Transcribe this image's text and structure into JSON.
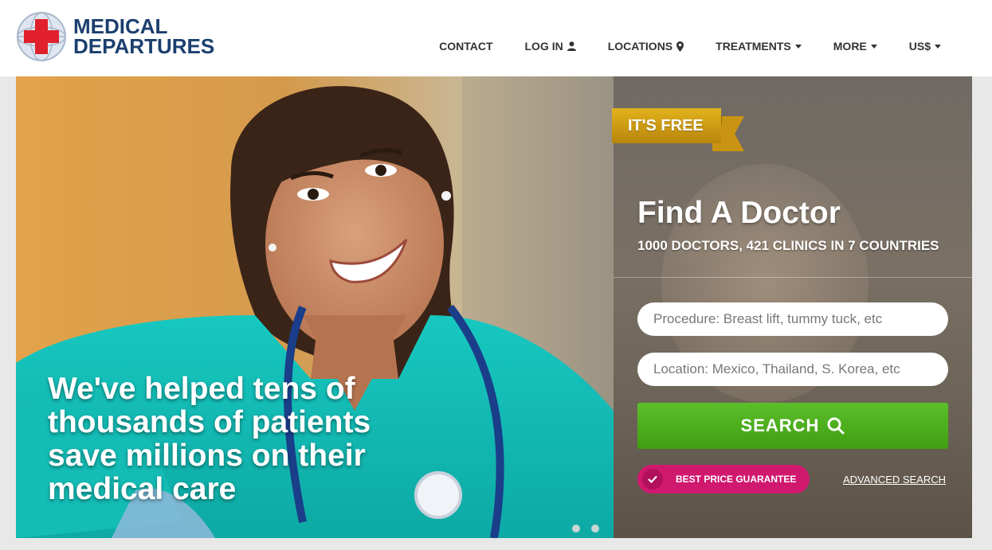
{
  "brand": {
    "line1": "MEDICAL",
    "line2": "DEPARTURES",
    "colors": {
      "navy": "#1b3f6e",
      "red": "#e0202c"
    }
  },
  "nav": {
    "contact": "CONTACT",
    "login": "LOG IN",
    "locations": "LOCATIONS",
    "treatments": "TREATMENTS",
    "more": "MORE",
    "currency": "US$"
  },
  "hero": {
    "tagline": "We've helped tens of thousands of patients save millions on their medical care",
    "slides_count": 2
  },
  "search": {
    "badge": "IT'S FREE",
    "title": "Find A Doctor",
    "subtitle": "1000 DOCTORS, 421 CLINICS IN 7 COUNTRIES",
    "procedure_placeholder": "Procedure: Breast lift, tummy tuck, etc",
    "location_placeholder": "Location: Mexico, Thailand, S. Korea, etc",
    "button": "SEARCH",
    "guarantee": "BEST PRICE GUARANTEE",
    "advanced": "ADVANCED SEARCH",
    "colors": {
      "button": "#4caf1e",
      "guarantee": "#d0186f",
      "badge": "#d4a017"
    }
  }
}
